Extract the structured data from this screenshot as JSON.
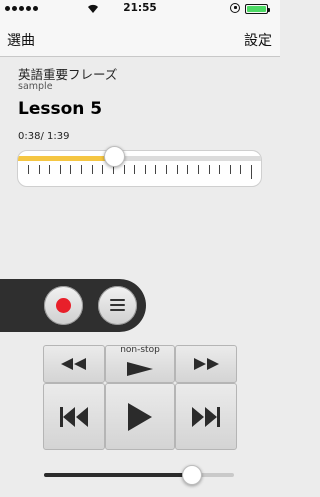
{
  "status_bar": {
    "time": "21:55",
    "signal_icon": "signal-dots-icon",
    "wifi_icon": "wifi-icon",
    "lock_icon": "orientation-lock-icon",
    "battery_level": 1.0,
    "battery_color": "#4cd964"
  },
  "nav": {
    "left_label": "選曲",
    "right_label": "設定"
  },
  "track": {
    "title": "英語重要フレーズ",
    "subtitle": "sample",
    "lesson": "Lesson 5",
    "time_display": "0:38/ 1:39",
    "progress": 0.38,
    "progress_color": "#f5c642"
  },
  "recorder": {
    "record_icon": "record-icon",
    "menu_icon": "menu-icon",
    "record_color": "#e8202a"
  },
  "transport": {
    "nonstop_label": "non-stop",
    "rewind_icon": "rewind-icon",
    "nonstop_play_icon": "play-icon",
    "fast_forward_icon": "fast-forward-icon",
    "previous_icon": "skip-previous-icon",
    "play_icon": "play-icon",
    "next_icon": "skip-next-icon"
  },
  "volume": {
    "level": 0.77
  }
}
